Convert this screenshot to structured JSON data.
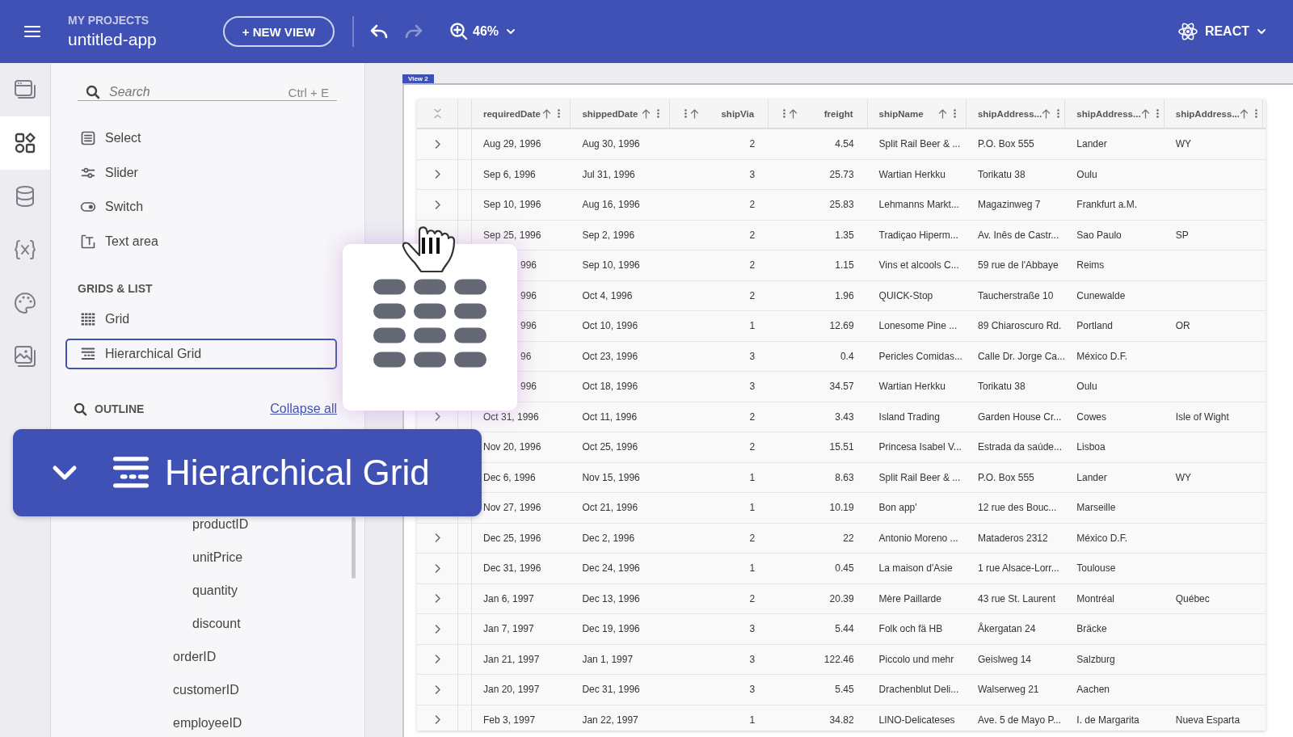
{
  "header": {
    "section": "MY PROJECTS",
    "project": "untitled-app",
    "new_view": "+ NEW VIEW",
    "actions": [
      {
        "kind": "undo",
        "disabled": false
      },
      {
        "kind": "redo",
        "disabled": true
      }
    ],
    "zoom": "46%",
    "framework": "REACT"
  },
  "rail": [
    {
      "kind": "views",
      "selected": false
    },
    {
      "kind": "components",
      "selected": true
    },
    {
      "kind": "data",
      "selected": false
    },
    {
      "kind": "variables",
      "selected": false
    },
    {
      "kind": "theme",
      "selected": false
    },
    {
      "kind": "assets",
      "selected": false
    }
  ],
  "panel": {
    "search": {
      "placeholder": "Search",
      "shortcut": "Ctrl + E"
    },
    "groups": [
      {
        "items": [
          {
            "kind": "select",
            "label": "Select",
            "selected": false
          },
          {
            "kind": "slider",
            "label": "Slider",
            "selected": false
          },
          {
            "kind": "switch",
            "label": "Switch",
            "selected": false
          },
          {
            "kind": "textarea",
            "label": "Text area",
            "selected": false
          }
        ]
      },
      {
        "title": "GRIDS & LIST",
        "items": [
          {
            "kind": "grid",
            "label": "Grid",
            "selected": false
          },
          {
            "kind": "hgrid",
            "label": "Hierarchical Grid",
            "selected": true
          }
        ]
      }
    ],
    "outline": {
      "title": "OUTLINE",
      "collapse_link": "Collapse all",
      "items": [
        {
          "children": [
            {
              "label": "productID"
            },
            {
              "label": "unitPrice"
            },
            {
              "label": "quantity"
            },
            {
              "label": "discount"
            }
          ]
        },
        {
          "label": "orderID"
        },
        {
          "label": "customerID"
        },
        {
          "label": "employeeID"
        }
      ]
    }
  },
  "drag_preview": {
    "kind": "hgrid"
  },
  "drag_ghost": {
    "label": "Hierarchical Grid",
    "expanded": true
  },
  "canvas": {
    "view_tag": "View 2",
    "table": {
      "columns": [
        {
          "label": "requiredDate",
          "kind": "text"
        },
        {
          "label": "shippedDate",
          "kind": "text"
        },
        {
          "label": "shipVia",
          "kind": "number"
        },
        {
          "label": "freight",
          "kind": "number"
        },
        {
          "label": "shipName",
          "kind": "text"
        },
        {
          "label": "shipAddress...",
          "kind": "text"
        },
        {
          "label": "shipAddress...",
          "kind": "text"
        },
        {
          "label": "shipAddress...",
          "kind": "text"
        }
      ],
      "rows": [
        {
          "first_covered": false,
          "cells": [
            "Aug 29, 1996",
            "Aug 30, 1996",
            "2",
            "4.54",
            "Split Rail Beer & ...",
            "P.O. Box 555",
            "Lander",
            "WY"
          ]
        },
        {
          "first_covered": false,
          "cells": [
            "Sep 6, 1996",
            "Jul 31, 1996",
            "3",
            "25.73",
            "Wartian Herkku",
            "Torikatu 38",
            "Oulu",
            null
          ]
        },
        {
          "first_covered": false,
          "cells": [
            "Sep 10, 1996",
            "Aug 16, 1996",
            "2",
            "25.83",
            "Lehmanns Markt...",
            "Magazinweg 7",
            "Frankfurt a.M.",
            null
          ]
        },
        {
          "first_covered": false,
          "cells": [
            "Sep 25, 1996",
            "Sep 2, 1996",
            "2",
            "1.35",
            "Tradiçao Hiperm...",
            "Av. Inês de Castr...",
            "Sao Paulo",
            "SP"
          ]
        },
        {
          "first_covered": true,
          "cells": [
            "996",
            "Sep 10, 1996",
            "2",
            "1.15",
            "Vins et alcools C...",
            "59 rue de l'Abbaye",
            "Reims",
            null
          ]
        },
        {
          "first_covered": true,
          "cells": [
            "996",
            "Oct 4, 1996",
            "2",
            "1.96",
            "QUICK-Stop",
            "Taucherstraße 10",
            "Cunewalde",
            null
          ]
        },
        {
          "first_covered": true,
          "cells": [
            "996",
            "Oct 10, 1996",
            "1",
            "12.69",
            "Lonesome Pine ...",
            "89 Chiaroscuro Rd.",
            "Portland",
            "OR"
          ]
        },
        {
          "first_covered": true,
          "cells": [
            "96",
            "Oct 23, 1996",
            "3",
            "0.4",
            "Pericles Comidas...",
            "Calle Dr. Jorge Ca...",
            "México D.F.",
            null
          ]
        },
        {
          "first_covered": true,
          "cells": [
            "996",
            "Oct 18, 1996",
            "3",
            "34.57",
            "Wartian Herkku",
            "Torikatu 38",
            "Oulu",
            null
          ]
        },
        {
          "first_covered": false,
          "cells": [
            "Oct 31, 1996",
            "Oct 11, 1996",
            "2",
            "3.43",
            "Island Trading",
            "Garden House Cr...",
            "Cowes",
            "Isle of Wight"
          ]
        },
        {
          "first_covered": false,
          "cells": [
            "Nov 20, 1996",
            "Oct 25, 1996",
            "2",
            "15.51",
            "Princesa Isabel V...",
            "Estrada da saúde...",
            "Lisboa",
            null
          ]
        },
        {
          "first_covered": false,
          "cells": [
            "Dec 6, 1996",
            "Nov 15, 1996",
            "1",
            "8.63",
            "Split Rail Beer & ...",
            "P.O. Box 555",
            "Lander",
            "WY"
          ]
        },
        {
          "first_covered": false,
          "cells": [
            "Nov 27, 1996",
            "Oct 21, 1996",
            "1",
            "10.19",
            "Bon app'",
            "12 rue des Bouc...",
            "Marseille",
            null
          ]
        },
        {
          "first_covered": false,
          "cells": [
            "Dec 25, 1996",
            "Dec 2, 1996",
            "2",
            "22",
            "Antonio Moreno ...",
            "Mataderos 2312",
            "México D.F.",
            null
          ]
        },
        {
          "first_covered": false,
          "cells": [
            "Dec 31, 1996",
            "Dec 24, 1996",
            "1",
            "0.45",
            "La maison d'Asie",
            "1 rue Alsace-Lorr...",
            "Toulouse",
            null
          ]
        },
        {
          "first_covered": false,
          "cells": [
            "Jan 6, 1997",
            "Dec 13, 1996",
            "2",
            "20.39",
            "Mère Paillarde",
            "43 rue St. Laurent",
            "Montréal",
            "Québec"
          ]
        },
        {
          "first_covered": false,
          "cells": [
            "Jan 7, 1997",
            "Dec 19, 1996",
            "3",
            "5.44",
            "Folk och fä HB",
            "Åkergatan 24",
            "Bräcke",
            null
          ]
        },
        {
          "first_covered": false,
          "cells": [
            "Jan 21, 1997",
            "Jan 1, 1997",
            "3",
            "122.46",
            "Piccolo und mehr",
            "Geislweg 14",
            "Salzburg",
            null
          ]
        },
        {
          "first_covered": false,
          "cells": [
            "Jan 20, 1997",
            "Dec 31, 1996",
            "3",
            "5.45",
            "Drachenblut Deli...",
            "Walserweg 21",
            "Aachen",
            null
          ]
        },
        {
          "first_covered": false,
          "cells": [
            "Feb 3, 1997",
            "Jan 22, 1997",
            "1",
            "34.82",
            "LINO-Delicateses",
            "Ave. 5 de Mayo P...",
            "I. de Margarita",
            "Nueva Esparta"
          ]
        }
      ]
    }
  }
}
